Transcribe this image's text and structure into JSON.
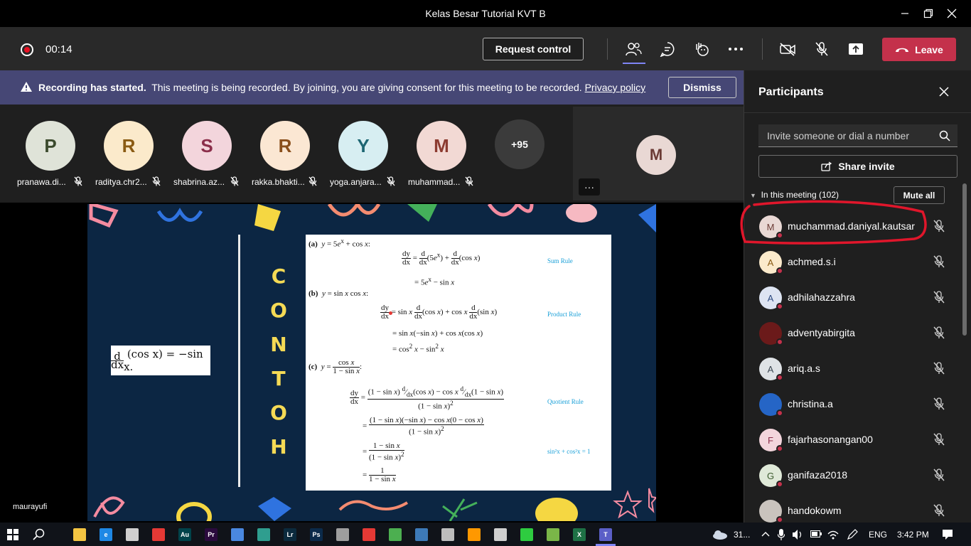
{
  "window": {
    "title": "Kelas Besar Tutorial KVT B"
  },
  "toolbar": {
    "timer": "00:14",
    "request_control": "Request control",
    "leave": "Leave"
  },
  "banner": {
    "bold": "Recording has started.",
    "text": "This meeting is being recorded. By joining, you are giving consent for this meeting to be recorded.",
    "link": "Privacy policy",
    "dismiss": "Dismiss"
  },
  "strip": {
    "participants": [
      {
        "initial": "P",
        "name": "pranawa.di...",
        "bg": "#dfe3d8",
        "fg": "#3b4a2d"
      },
      {
        "initial": "R",
        "name": "raditya.chr2...",
        "bg": "#fbeacb",
        "fg": "#8a5b13"
      },
      {
        "initial": "S",
        "name": "shabrina.az...",
        "bg": "#f3d5dc",
        "fg": "#8b2e4a"
      },
      {
        "initial": "R",
        "name": "rakka.bhakti...",
        "bg": "#fbe7d3",
        "fg": "#8a4f1c"
      },
      {
        "initial": "Y",
        "name": "yoga.anjara...",
        "bg": "#d7eef2",
        "fg": "#1d6673"
      },
      {
        "initial": "M",
        "name": "muhammad...",
        "bg": "#f2d9d4",
        "fg": "#8c3b30"
      }
    ],
    "more": "+95",
    "self_initial": "M",
    "self_more": "···"
  },
  "stage": {
    "presenter": "maurayufi",
    "contoh": [
      "C",
      "O",
      "N",
      "T",
      "O",
      "H"
    ],
    "rules": {
      "sum": "Sum Rule",
      "product": "Product Rule",
      "quotient": "Quotient Rule",
      "identity": "sin²x + cos²x = 1"
    }
  },
  "panel": {
    "title": "Participants",
    "invite_placeholder": "Invite someone or dial a number",
    "share_invite": "Share invite",
    "in_meeting": "In this meeting (102)",
    "mute_all": "Mute all",
    "people": [
      {
        "initial": "M",
        "name": "muchammad.daniyal.kautsar",
        "bg": "#e9d8d4",
        "fg": "#6b3b35"
      },
      {
        "initial": "A",
        "name": "achmed.s.i",
        "bg": "#fbeacb",
        "fg": "#8a5b13"
      },
      {
        "initial": "A",
        "name": "adhilahazzahra",
        "bg": "#dde4f2",
        "fg": "#2d4a80"
      },
      {
        "initial": "",
        "name": "adventyabirgita",
        "bg": "#6b1a1a",
        "fg": "#fff"
      },
      {
        "initial": "A",
        "name": "ariq.a.s",
        "bg": "#dfe3e6",
        "fg": "#3a4550"
      },
      {
        "initial": "",
        "name": "christina.a",
        "bg": "#2565c6",
        "fg": "#fff"
      },
      {
        "initial": "F",
        "name": "fajarhasonangan00",
        "bg": "#f3d5dc",
        "fg": "#8b2e4a"
      },
      {
        "initial": "G",
        "name": "ganifaza2018",
        "bg": "#dfe9d8",
        "fg": "#3b5a2d"
      },
      {
        "initial": "",
        "name": "handokowm",
        "bg": "#c9c3bd",
        "fg": "#333"
      }
    ]
  },
  "taskbar": {
    "apps": [
      {
        "label": "",
        "color": "#f4c542"
      },
      {
        "label": "e",
        "color": "#1e88e5"
      },
      {
        "label": "",
        "color": "#cfcfcf"
      },
      {
        "label": "",
        "color": "#e53935"
      },
      {
        "label": "Au",
        "color": "#00434a"
      },
      {
        "label": "Pr",
        "color": "#2a0a3d"
      },
      {
        "label": "",
        "color": "#4a88e0"
      },
      {
        "label": "",
        "color": "#2f9e8f"
      },
      {
        "label": "Lr",
        "color": "#0b2a3d"
      },
      {
        "label": "Ps",
        "color": "#0b2a4a"
      },
      {
        "label": "",
        "color": "#9e9e9e"
      },
      {
        "label": "",
        "color": "#e53935"
      },
      {
        "label": "",
        "color": "#4caf50"
      },
      {
        "label": "",
        "color": "#3d7ab8"
      },
      {
        "label": "",
        "color": "#bdbdbd"
      },
      {
        "label": "",
        "color": "#ff9800"
      },
      {
        "label": "",
        "color": "#cfcfcf"
      },
      {
        "label": "",
        "color": "#2ecc40"
      },
      {
        "label": "",
        "color": "#7ab648"
      },
      {
        "label": "X",
        "color": "#1e7145"
      },
      {
        "label": "T",
        "color": "#5b5fc7"
      }
    ],
    "temp": "31...",
    "lang": "ENG",
    "time": "3:42 PM"
  }
}
